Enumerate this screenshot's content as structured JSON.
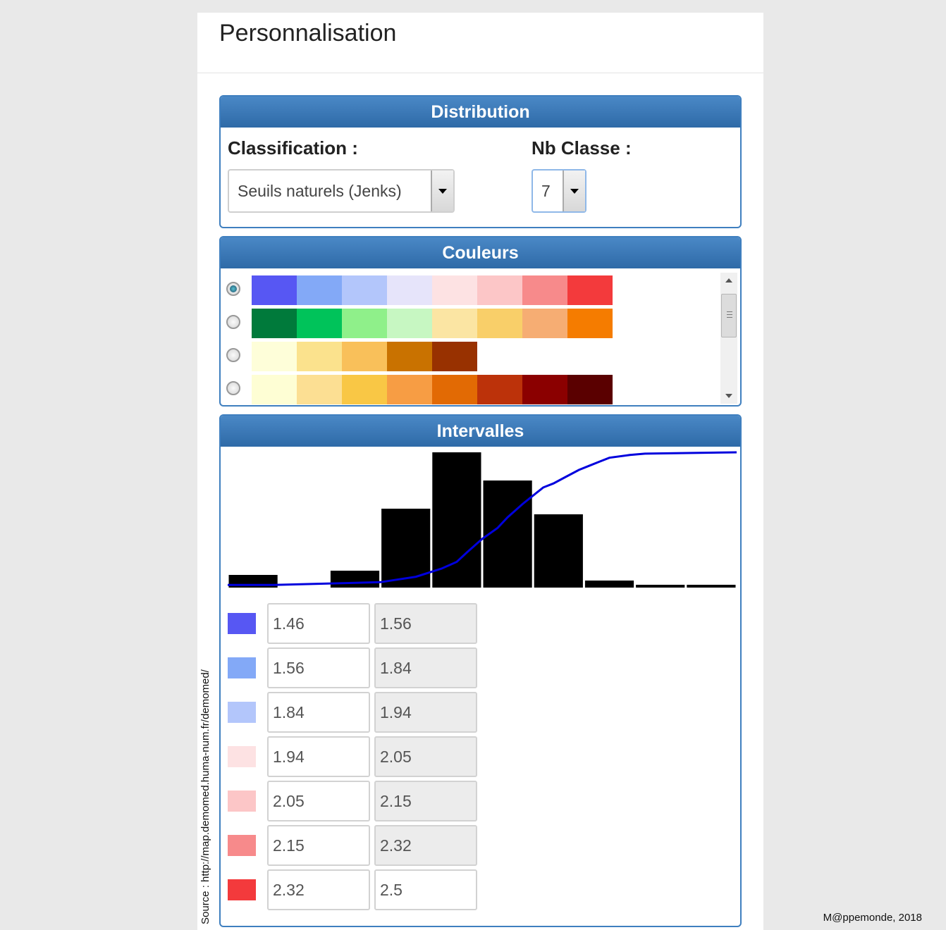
{
  "page": {
    "title": "Personnalisation"
  },
  "distribution": {
    "header": "Distribution",
    "classification_label": "Classification :",
    "classification_value": "Seuils naturels (Jenks)",
    "nb_classe_label": "Nb Classe :",
    "nb_classe_value": "7"
  },
  "couleurs": {
    "header": "Couleurs",
    "palettes": [
      {
        "selected": true,
        "colors": [
          "#5757f3",
          "#83a9f7",
          "#b3c6fb",
          "#e6e4fa",
          "#fde2e3",
          "#fcc6c7",
          "#f78a8b",
          "#f33a3c"
        ]
      },
      {
        "selected": false,
        "colors": [
          "#007a3b",
          "#00c35a",
          "#8ff08a",
          "#c7f7c2",
          "#fbe5a3",
          "#f9cf69",
          "#f6ad73",
          "#f57c00"
        ]
      },
      {
        "selected": false,
        "colors": [
          "#fefed9",
          "#fbe28d",
          "#f9c05a",
          "#c97200",
          "#983100"
        ]
      },
      {
        "selected": false,
        "colors": [
          "#fefed4",
          "#fcdf93",
          "#f9c745",
          "#f79d44",
          "#e26a04",
          "#bc320a",
          "#8b0000",
          "#5a0000"
        ]
      }
    ]
  },
  "intervalles": {
    "header": "Intervalles",
    "rows": [
      {
        "color": "#5757f3",
        "from": "1.46",
        "to": "1.56",
        "to_editable": false
      },
      {
        "color": "#83a9f7",
        "from": "1.56",
        "to": "1.84",
        "to_editable": false
      },
      {
        "color": "#b3c6fb",
        "from": "1.84",
        "to": "1.94",
        "to_editable": false
      },
      {
        "color": "#fde2e3",
        "from": "1.94",
        "to": "2.05",
        "to_editable": false
      },
      {
        "color": "#fcc6c7",
        "from": "2.05",
        "to": "2.15",
        "to_editable": false
      },
      {
        "color": "#f78a8b",
        "from": "2.15",
        "to": "2.32",
        "to_editable": false
      },
      {
        "color": "#f33a3c",
        "from": "2.32",
        "to": "2.5",
        "to_editable": true
      }
    ]
  },
  "chart_data": {
    "type": "bar",
    "bar_color": "#000000",
    "values": [
      9,
      0,
      12,
      56,
      96,
      76,
      52,
      5,
      2,
      2
    ],
    "ylim": [
      0,
      96
    ],
    "cumulative_line": {
      "color": "#0000dd",
      "x": [
        0,
        0.09,
        0.3,
        0.37,
        0.42,
        0.45,
        0.47,
        0.5,
        0.53,
        0.55,
        0.58,
        0.6,
        0.62,
        0.64,
        0.66,
        0.69,
        0.71,
        0.73,
        0.75,
        0.79,
        0.82,
        1.0
      ],
      "y": [
        0.02,
        0.02,
        0.04,
        0.08,
        0.14,
        0.19,
        0.26,
        0.36,
        0.44,
        0.52,
        0.62,
        0.68,
        0.74,
        0.77,
        0.81,
        0.87,
        0.9,
        0.93,
        0.96,
        0.98,
        0.99,
        1.0
      ]
    }
  },
  "footer": {
    "source": "Source : http://map.demomed.huma-num.fr/demomed/",
    "credit": "M@ppemonde, 2018"
  }
}
